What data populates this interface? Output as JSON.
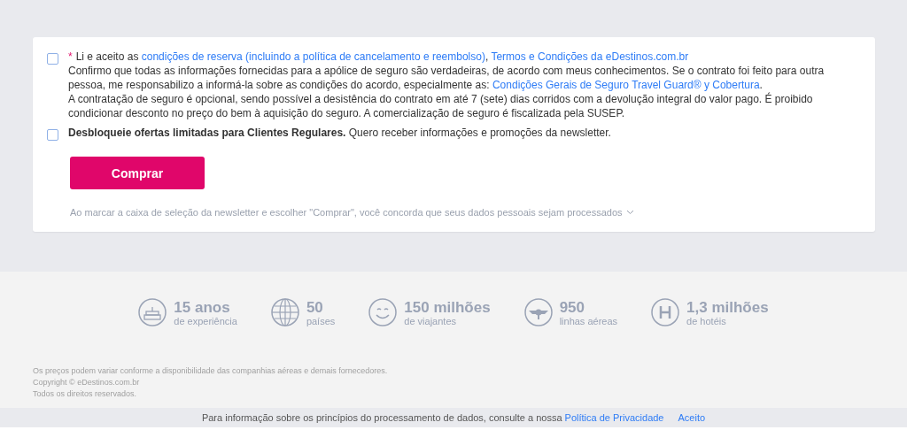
{
  "consents": [
    {
      "checked": false,
      "required_mark": "*",
      "paragraphs": [
        [
          {
            "kind": "text",
            "text": "Li e aceito as "
          },
          {
            "kind": "link",
            "text": "condições de reserva (incluindo a política de cancelamento e reembolso)"
          },
          {
            "kind": "text",
            "text": ", "
          },
          {
            "kind": "link",
            "text": "Termos e Condições da eDestinos.com.br"
          }
        ],
        [
          {
            "kind": "text",
            "text": "Confirmo que todas as informações fornecidas para a apólice de seguro são verdadeiras, de acordo com meus conhecimentos. Se o contrato foi feito para outra pessoa, me responsabilizo a informá-la sobre as condições do acordo, especialmente as: "
          },
          {
            "kind": "link",
            "text": "Condições Gerais de Seguro Travel Guard® y Cobertura"
          },
          {
            "kind": "text",
            "text": "."
          }
        ],
        [
          {
            "kind": "text",
            "text": "A contratação de seguro é opcional, sendo possível a desistência do contrato em até 7 (sete) dias corridos com a devolução integral do valor pago. É proibido condicionar desconto no preço do bem à aquisição do seguro. A comercialização de seguro é fiscalizada pela SUSEP."
          }
        ]
      ]
    },
    {
      "checked": false,
      "paragraphs": [
        [
          {
            "kind": "bold",
            "text": "Desbloqueie ofertas limitadas para Clientes Regulares."
          },
          {
            "kind": "text",
            "text": " Quero receber informações e promoções da newsletter."
          }
        ]
      ]
    }
  ],
  "buy_button": "Comprar",
  "data_notice": "Ao marcar a caixa de seleção da newsletter e escolher \"Comprar\", você concorda que seus dados pessoais sejam processados",
  "stats": [
    {
      "kind": "cake",
      "value": "15 anos",
      "label": "de experiência"
    },
    {
      "kind": "globe",
      "value": "50",
      "label": "países"
    },
    {
      "kind": "smile",
      "value": "150 milhões",
      "label": "de viajantes"
    },
    {
      "kind": "plane",
      "value": "950",
      "label": "linhas aéreas"
    },
    {
      "kind": "hotel",
      "value": "1,3 milhões",
      "label": "de hotéis"
    }
  ],
  "footer_lines": [
    "Os preços podem variar conforme a disponibilidade das companhias aéreas e demais fornecedores.",
    "Copyright © eDestinos.com.br",
    "Todos os direitos reservados."
  ],
  "cookie_bar": {
    "text": "Para informação sobre os princípios do processamento de dados, consulte a nossa ",
    "link": "Política de Privacidade",
    "accept": "Aceito"
  }
}
